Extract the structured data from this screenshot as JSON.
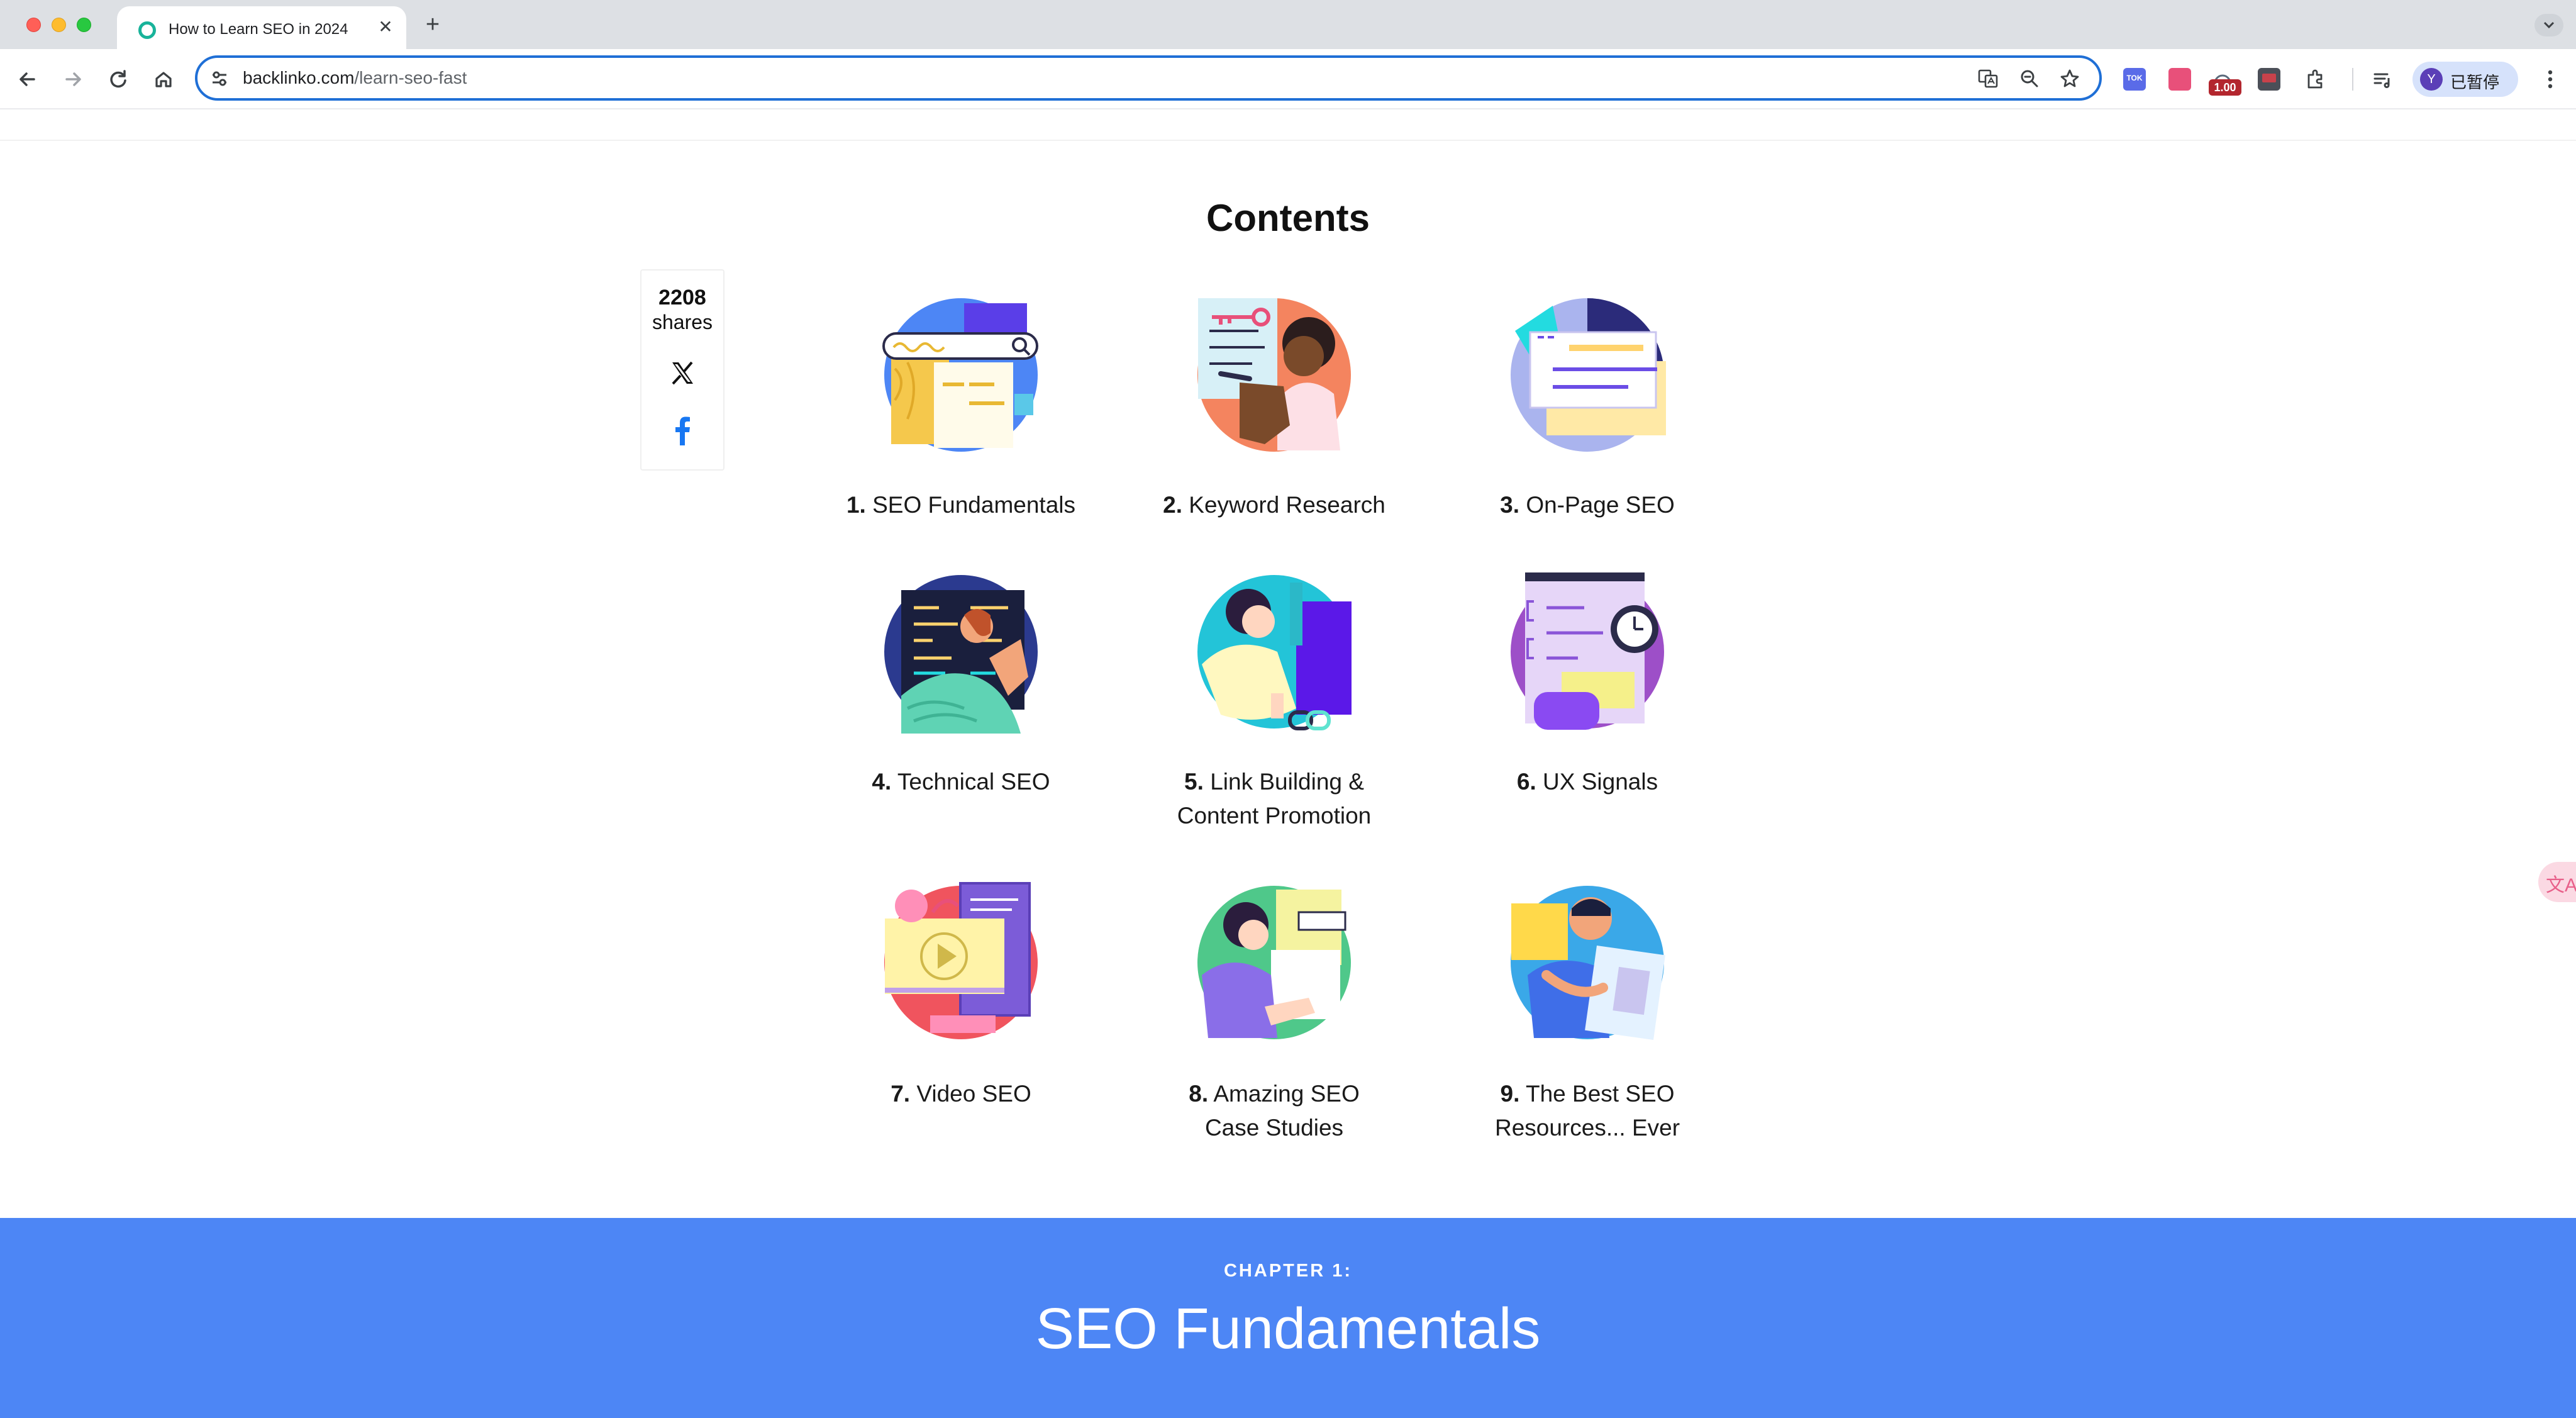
{
  "browser": {
    "tab_title": "How to Learn SEO in 2024",
    "new_tab_symbol": "+",
    "close_symbol": "✕",
    "url_domain": "backlinko.com",
    "url_path": "/learn-seo-fast",
    "extension_badge": "1.00",
    "extension_label": "TOK",
    "profile_initial": "Y",
    "profile_label": "已暂停",
    "icons": [
      "back-icon",
      "forward-icon",
      "reload-icon",
      "home-icon",
      "site-settings-icon",
      "translate-icon",
      "zoom-icon",
      "bookmark-star-icon",
      "extensions-puzzle-icon",
      "reading-list-icon",
      "menu-kebab-icon"
    ]
  },
  "page": {
    "contents_title": "Contents",
    "share": {
      "count": "2208",
      "label": "shares"
    },
    "toc": [
      {
        "num": "1.",
        "label": "SEO Fundamentals"
      },
      {
        "num": "2.",
        "label": "Keyword Research"
      },
      {
        "num": "3.",
        "label": "On-Page SEO"
      },
      {
        "num": "4.",
        "label": "Technical SEO"
      },
      {
        "num": "5.",
        "label": "Link Building &",
        "label2": "Content Promotion"
      },
      {
        "num": "6.",
        "label": "UX Signals"
      },
      {
        "num": "7.",
        "label": "Video SEO"
      },
      {
        "num": "8.",
        "label": "Amazing SEO",
        "label2": "Case Studies"
      },
      {
        "num": "9.",
        "label": "The Best SEO",
        "label2": "Resources... Ever"
      }
    ],
    "chapter": {
      "kicker": "CHAPTER 1:",
      "title": "SEO Fundamentals"
    },
    "translate_float_symbol": "文A"
  },
  "colors": {
    "chapter_band": "#4d86f5",
    "omnibox_focus": "#1f6fd6",
    "facebook": "#1877f2"
  }
}
